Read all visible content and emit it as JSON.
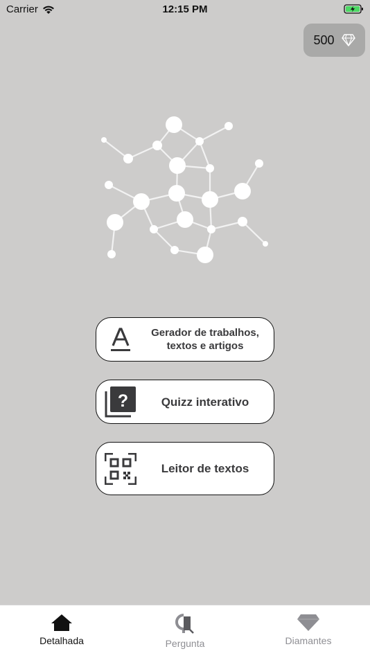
{
  "status_bar": {
    "carrier": "Carrier",
    "time": "12:15 PM"
  },
  "diamonds": {
    "count": "500",
    "icon": "diamond-icon"
  },
  "features": [
    {
      "label": "Gerador de trabalhos, textos e artigos",
      "icon": "text-format-icon"
    },
    {
      "label": "Quizz interativo",
      "icon": "quiz-icon"
    },
    {
      "label": "Leitor de textos",
      "icon": "qr-scan-icon"
    }
  ],
  "tab_bar": {
    "items": [
      {
        "label": "Detalhada",
        "icon": "home-icon",
        "active": true
      },
      {
        "label": "Pergunta",
        "icon": "question-icon",
        "active": false
      },
      {
        "label": "Diamantes",
        "icon": "diamond-icon",
        "active": false
      }
    ]
  },
  "colors": {
    "background": "#cdcccb",
    "badge": "#a9a9a8",
    "button_border": "#111111",
    "tab_inactive": "#8e8e93",
    "battery": "#4cd964"
  }
}
